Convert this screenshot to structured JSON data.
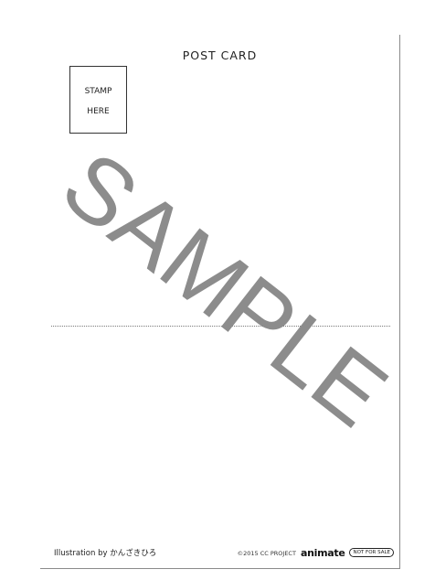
{
  "card": {
    "title": "POST CARD",
    "stamp_box": {
      "line1": "STAMP",
      "line2": "HERE"
    },
    "watermark": "SAMPLE",
    "watermark_color": "#8c8c8c",
    "footer": {
      "illustration": "Illustration by かんざきひろ",
      "copyright": "©2015 CC PROJECT",
      "brand": "animate",
      "badge": "NOT FOR SALE"
    }
  }
}
